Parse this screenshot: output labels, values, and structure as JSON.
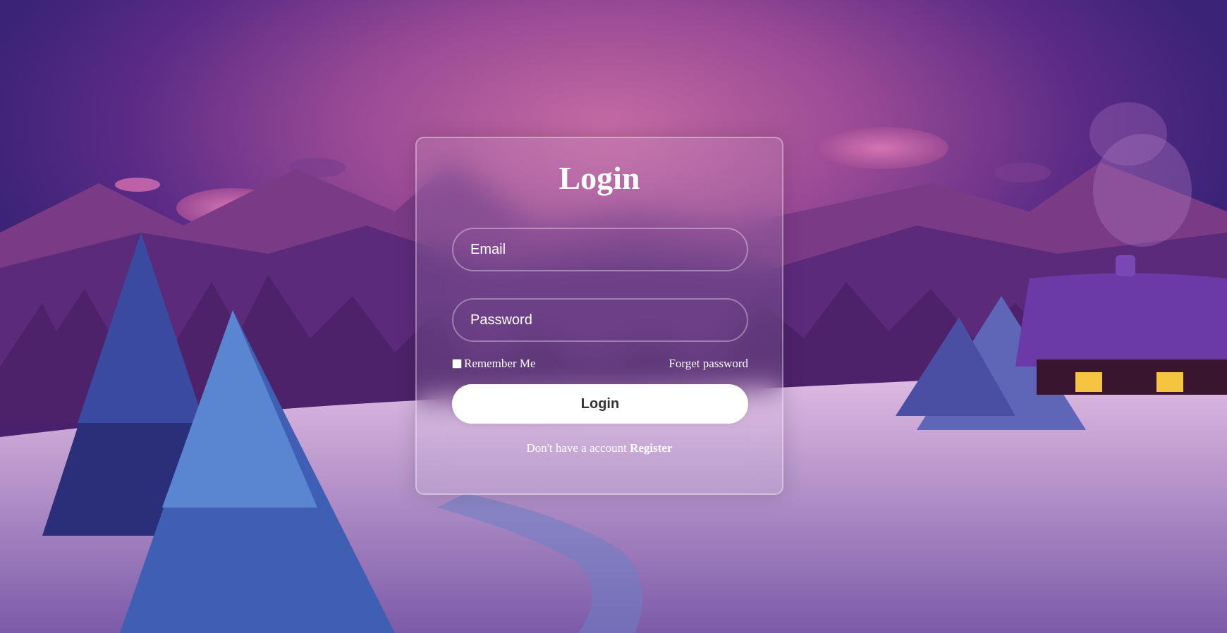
{
  "login": {
    "title": "Login",
    "email_placeholder": "Email",
    "password_placeholder": "Password",
    "remember_label": "Remember Me",
    "forget_label": "Forget password",
    "login_button": "Login",
    "no_account_text": "Don't have a account",
    "register_label": "Register"
  },
  "colors": {
    "sky_top": "#3b2378",
    "sky_glow": "#c46aa3",
    "snow": "#d8b8e0",
    "button_bg": "#ffffff",
    "button_text": "#333333"
  }
}
